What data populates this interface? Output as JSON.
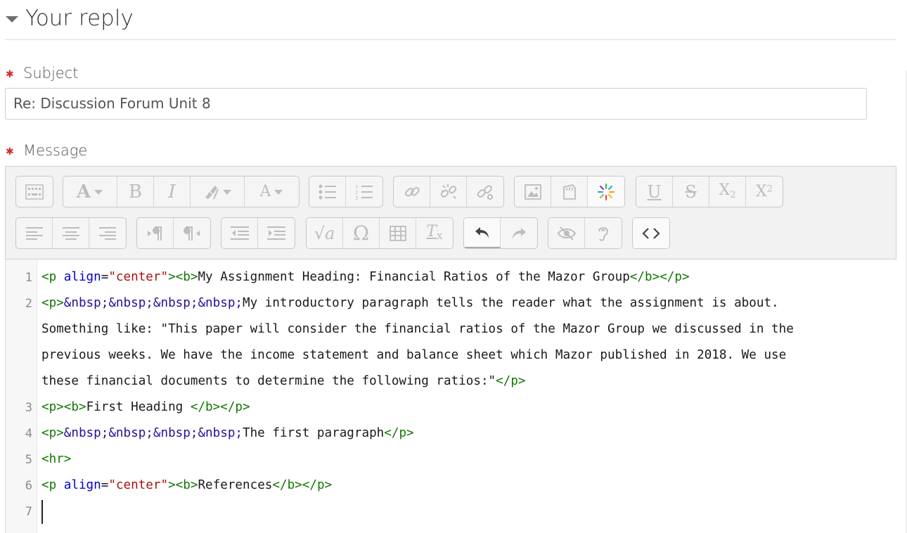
{
  "section": {
    "title": "Your reply"
  },
  "subject": {
    "label": "Subject",
    "required_mark": "✱",
    "value": "Re: Discussion Forum Unit 8"
  },
  "message": {
    "label": "Message",
    "required_mark": "✱"
  },
  "toolbar": {
    "row1": [
      [
        "toolbar-toggle"
      ],
      [
        "font-family",
        "bold",
        "italic",
        "highlight-color",
        "font-color"
      ],
      [
        "unordered-list",
        "ordered-list"
      ],
      [
        "link",
        "unlink",
        "manage-links"
      ],
      [
        "image",
        "media",
        "recordrtc"
      ],
      [
        "underline",
        "strike",
        "subscript",
        "superscript"
      ]
    ],
    "row2": [
      [
        "align-left",
        "align-center",
        "align-right"
      ],
      [
        "ltr",
        "rtl"
      ],
      [
        "outdent",
        "indent"
      ],
      [
        "equation",
        "special-chars",
        "table",
        "clear-formatting"
      ],
      [
        "undo",
        "redo"
      ],
      [
        "accessibility-checker",
        "screen-reader-helper"
      ],
      [
        "html-source"
      ]
    ],
    "glyphs": {
      "bold": "B",
      "italic": "I",
      "underline": "U",
      "strike": "S",
      "subscript_base": "X",
      "subscript_sub": "2",
      "superscript_base": "X",
      "superscript_sup": "2",
      "equation": "√a",
      "special_chars": "Ω",
      "clear_base": "T",
      "clear_sub": "x",
      "font_a": "A",
      "font_color_a": "A",
      "html": "<>"
    }
  },
  "editor": {
    "line_numbers": [
      "1",
      "2",
      "3",
      "4",
      "5",
      "6",
      "7"
    ],
    "lines": [
      [
        {
          "t": "tag",
          "v": "<p "
        },
        {
          "t": "attr",
          "v": "align"
        },
        {
          "t": "txt",
          "v": "="
        },
        {
          "t": "str",
          "v": "\"center\""
        },
        {
          "t": "tag",
          "v": "><b>"
        },
        {
          "t": "txt",
          "v": "My Assignment Heading: Financial Ratios of the Mazor Group"
        },
        {
          "t": "tag",
          "v": "</b></p>"
        }
      ],
      [
        {
          "t": "tag",
          "v": "<p>"
        },
        {
          "t": "ent",
          "v": "&nbsp;&nbsp;&nbsp;&nbsp;"
        },
        {
          "t": "txt",
          "v": "My introductory paragraph tells the reader what the assignment is about."
        }
      ],
      [
        {
          "t": "txt",
          "v": "Something like: \"This paper will consider the financial ratios of the Mazor Group we discussed in the"
        }
      ],
      [
        {
          "t": "txt",
          "v": "previous weeks. We have the income statement and balance sheet which Mazor published in 2018. We use"
        }
      ],
      [
        {
          "t": "txt",
          "v": "these financial documents to determine the following ratios:\""
        },
        {
          "t": "tag",
          "v": "</p>"
        }
      ],
      [
        {
          "t": "tag",
          "v": "<p><b>"
        },
        {
          "t": "txt",
          "v": "First Heading "
        },
        {
          "t": "tag",
          "v": "</b></p>"
        }
      ],
      [
        {
          "t": "tag",
          "v": "<p>"
        },
        {
          "t": "ent",
          "v": "&nbsp;&nbsp;&nbsp;&nbsp;"
        },
        {
          "t": "txt",
          "v": "The first paragraph"
        },
        {
          "t": "tag",
          "v": "</p>"
        }
      ],
      [
        {
          "t": "tag",
          "v": "<hr>"
        }
      ],
      [
        {
          "t": "tag",
          "v": "<p "
        },
        {
          "t": "attr",
          "v": "align"
        },
        {
          "t": "txt",
          "v": "="
        },
        {
          "t": "str",
          "v": "\"center\""
        },
        {
          "t": "tag",
          "v": "><b>"
        },
        {
          "t": "txt",
          "v": "References"
        },
        {
          "t": "tag",
          "v": "</b></p>"
        }
      ],
      [
        {
          "t": "txt",
          "v": ""
        }
      ]
    ],
    "colors": {
      "tag": "#117700",
      "attr": "#0000cc",
      "string": "#aa1111",
      "entity": "#221199"
    }
  }
}
